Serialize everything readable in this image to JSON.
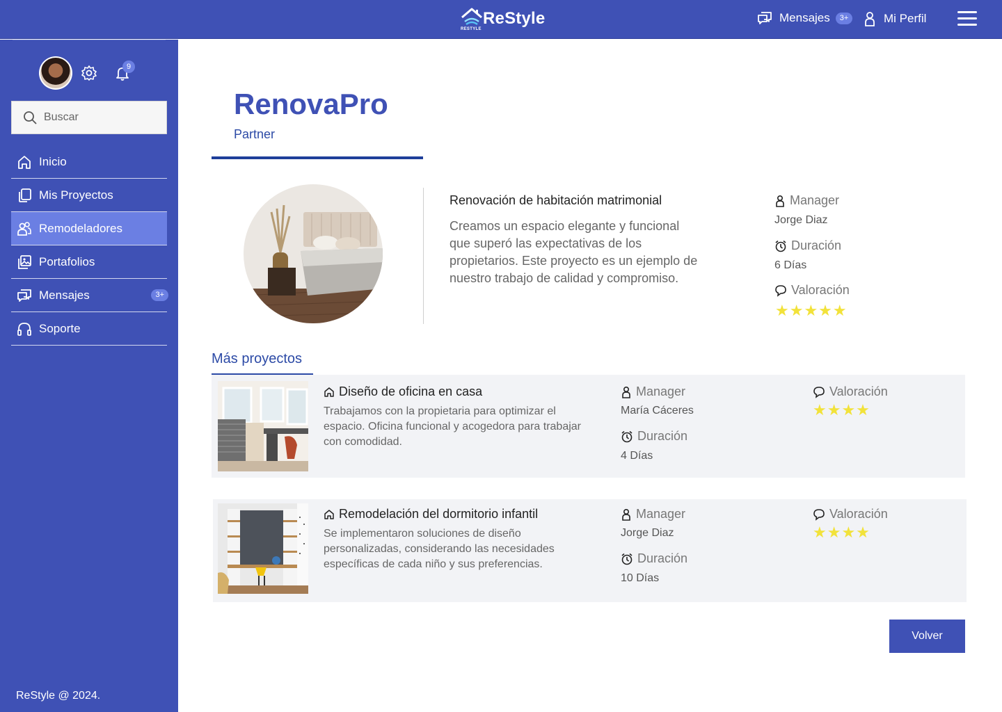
{
  "header": {
    "brand": "ReStyle",
    "brand_mini": "RESTYLE",
    "messages_label": "Mensajes",
    "messages_badge": "3+",
    "profile_label": "Mi Perfil"
  },
  "sidebar": {
    "notifications_count": "9",
    "search_placeholder": "Buscar",
    "items": [
      {
        "label": "Inicio",
        "icon": "home-icon"
      },
      {
        "label": "Mis Proyectos",
        "icon": "copy-icon"
      },
      {
        "label": "Remodeladores",
        "icon": "users-icon",
        "active": true
      },
      {
        "label": "Portafolios",
        "icon": "gallery-icon"
      },
      {
        "label": "Mensajes",
        "icon": "chat-icon",
        "badge": "3+"
      },
      {
        "label": "Soporte",
        "icon": "headphones-icon"
      }
    ],
    "footer": "ReStyle @ 2024."
  },
  "company": {
    "name": "RenovaPro",
    "tier": "Partner"
  },
  "featured": {
    "title": "Renovación de habitación matrimonial",
    "description": "Creamos un espacio elegante y funcional que superó las expectativas de los propietarios. Este proyecto es un ejemplo de nuestro trabajo de calidad y compromiso.",
    "manager_label": "Manager",
    "manager": "Jorge Diaz",
    "duration_label": "Duración",
    "duration": "6 Días",
    "rating_label": "Valoración",
    "rating": 5,
    "rating_stars": "★★★★★"
  },
  "more": {
    "title": "Más proyectos",
    "projects": [
      {
        "title": "Diseño de oficina en casa",
        "description": "Trabajamos con la propietaria para optimizar el espacio. Oficina funcional y acogedora para trabajar con comodidad.",
        "manager_label": "Manager",
        "manager": "María Cáceres",
        "duration_label": "Duración",
        "duration": "4 Días",
        "rating_label": "Valoración",
        "rating": 4,
        "rating_stars": "★★★★"
      },
      {
        "title": "Remodelación del dormitorio infantil",
        "description": "Se implementaron soluciones de diseño personalizadas, considerando las necesidades específicas de cada niño y sus preferencias.",
        "manager_label": "Manager",
        "manager": "Jorge Diaz",
        "duration_label": "Duración",
        "duration": "10 Días",
        "rating_label": "Valoración",
        "rating": 4,
        "rating_stars": "★★★★"
      }
    ]
  },
  "actions": {
    "back_label": "Volver"
  },
  "colors": {
    "primary": "#3f51b5",
    "active_nav": "#6b7fe3",
    "star": "#f2e23a",
    "card_bg": "#f2f3f6"
  }
}
